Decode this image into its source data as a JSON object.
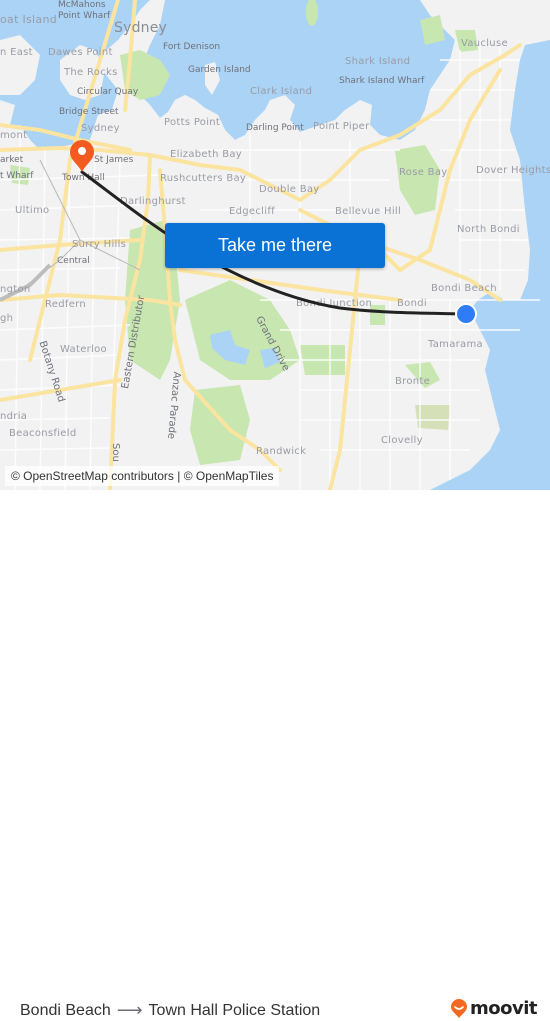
{
  "map": {
    "colors": {
      "water": "#aad3f5",
      "land": "#f2f2f2",
      "park": "#c8e6b0",
      "major_road": "#fbe4a0",
      "route_line": "#222222",
      "origin_marker": "#2e7cf6",
      "destination_marker": "#f25a1f",
      "button": "#0a72d4"
    },
    "labels": {
      "goat_island": "oat Island",
      "mcmahons_point": "McMahons\nPoint Wharf",
      "sydney_big": "Sydney",
      "balmain_east": "n East",
      "dawes_point": "Dawes Point",
      "the_rocks": "The Rocks",
      "circular_quay": "Circular Quay",
      "bridge_street": "Bridge Street",
      "sydney_small": "Sydney",
      "pyrmont": "mont",
      "market": "arket",
      "wharf": "t Wharf",
      "st_james": "St James",
      "town_hall": "Town Hall",
      "fort_denison": "Fort Denison",
      "garden_island": "Garden Island",
      "clark_island": "Clark Island",
      "potts_point": "Potts Point",
      "darling_point": "Darling Point",
      "point_piper": "Point Piper",
      "shark_island": "Shark Island",
      "shark_island_wharf": "Shark Island Wharf",
      "vaucluse": "Vaucluse",
      "elizabeth_bay": "Elizabeth Bay",
      "rushcutters_bay": "Rushcutters Bay",
      "darlinghurst": "Darlinghurst",
      "double_bay": "Double Bay",
      "edgecliff": "Edgecliff",
      "bellevue_hill": "Bellevue Hill",
      "rose_bay": "Rose Bay",
      "dover_heights": "Dover Heights",
      "north_bondi": "North Bondi",
      "ultimo": "Ultimo",
      "surry_hills": "Surry Hills",
      "central": "Central",
      "darlington": "ngton",
      "redfern": "Redfern",
      "eveleigh": "gh",
      "bondi_junction": "Bondi Junction",
      "bondi": "Bondi",
      "bondi_beach": "Bondi Beach",
      "tamarama": "Tamarama",
      "botany_road": "Botany Road",
      "waterloo": "Waterloo",
      "eastern_distributor": "Eastern Distributor",
      "anzac_parade": "Anzac Parade",
      "grand_drive": "Grand Drive",
      "bronte": "Bronte",
      "alexandria": "ndria",
      "beaconsfield": "Beaconsfield",
      "south": "Sou",
      "clovelly": "Clovelly",
      "randwick": "Randwick"
    },
    "cta_label": "Take me there",
    "attribution": "© OpenStreetMap contributors | © OpenMapTiles"
  },
  "route": {
    "origin": "Bondi Beach",
    "destination": "Town Hall Police Station",
    "arrow_icon": "right-arrow-icon"
  },
  "brand": {
    "name": "moovit",
    "color": "#f26a21"
  }
}
